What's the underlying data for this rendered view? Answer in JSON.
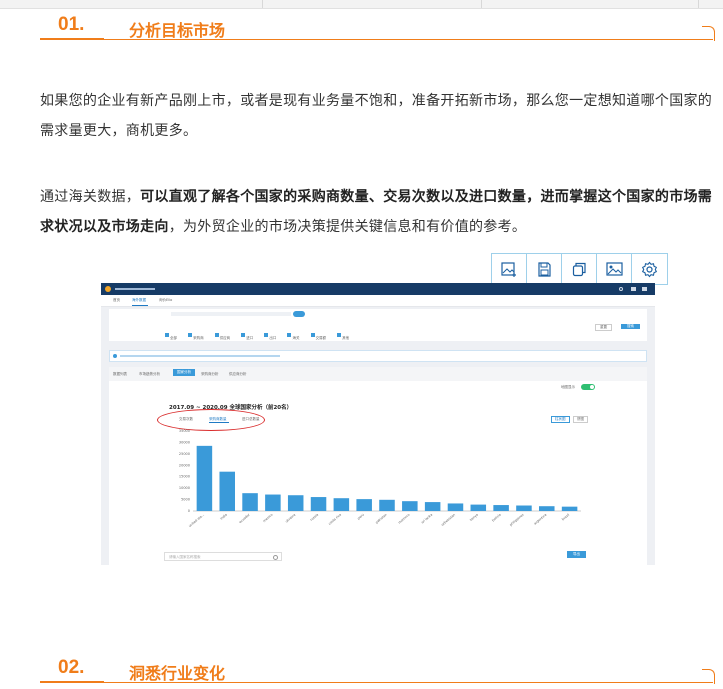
{
  "sections": [
    {
      "number": "01.",
      "title": "分析目标市场"
    },
    {
      "number": "02.",
      "title": "洞悉行业变化"
    }
  ],
  "paragraph1": "如果您的企业有新产品刚上市，或者是现有业务量不饱和，准备开拓新市场，那么您一定想知道哪个国家的需求量更大，商机更多。",
  "paragraph2": {
    "lead": "通过海关数据，",
    "bold": "可以直观了解各个国家的采购商数量、交易次数以及进口数量，进而掌握这个国家的市场需求状况以及市场走向",
    "tail": "，为外贸企业的市场决策提供关键信息和有价值的参考。"
  },
  "toolbar_icons": [
    "image-add-icon",
    "save-icon",
    "copy-icon",
    "image-icon",
    "settings-icon"
  ],
  "colors": {
    "accent": "#f07d1a",
    "chart_bar": "#3a9ad9",
    "app_header": "#163b66"
  },
  "screenshot": {
    "nav_tabs": [
      "首页",
      "海外数据",
      "询价Ello"
    ],
    "filter_options": [
      "全部",
      "采购商",
      "供应商",
      "进口",
      "出口",
      "海关",
      "交易额",
      "其他"
    ],
    "buttons": {
      "reset": "重置",
      "search": "搜索",
      "export": "导出"
    },
    "report_tabs": [
      "数据列表",
      "市场趋势分析",
      "国家分析",
      "采购商分析",
      "供应商分析"
    ],
    "toggle_label": "地图显示",
    "search_placeholder": "请输入国家名称搜索",
    "view_toggle": [
      "柱状图",
      "饼图"
    ],
    "metric_tabs": [
      "交易次数",
      "采购商数量",
      "进口总数量"
    ]
  },
  "chart_data": {
    "type": "bar",
    "title": "2017.09 ~ 2020.09 全球国家分析（前20名）",
    "categories": [
      "united sta...",
      "india",
      "ecuador",
      "mexico",
      "ukraine",
      "russia",
      "costa rica",
      "peru",
      "pakistan",
      "morocco",
      "sri lanka",
      "uzbekistan",
      "kenya",
      "bolivia",
      "philippines",
      "argentina",
      "brazil"
    ],
    "values": [
      28500,
      17200,
      7800,
      7200,
      6900,
      6100,
      5600,
      5200,
      4900,
      4300,
      3900,
      3300,
      2800,
      2600,
      2400,
      2100,
      1900
    ],
    "yticks": [
      0,
      5000,
      10000,
      15000,
      20000,
      25000,
      30000,
      35000
    ],
    "ylim": [
      0,
      35000
    ],
    "grid": false
  }
}
